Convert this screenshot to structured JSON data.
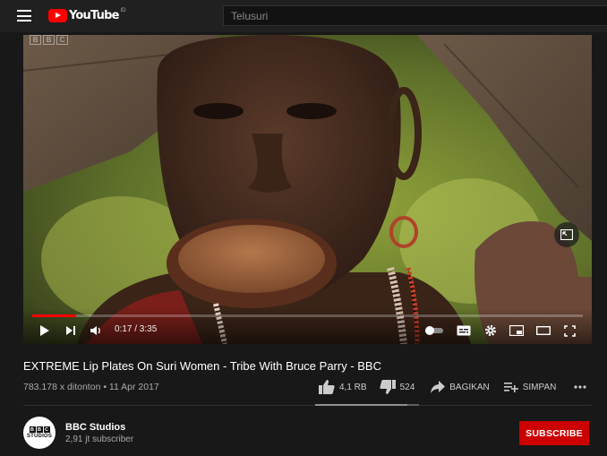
{
  "header": {
    "logo_text": "YouTube",
    "logo_country": "ID",
    "search_placeholder": "Telusuri"
  },
  "player": {
    "watermark": [
      "B",
      "B",
      "C"
    ],
    "current_time": "0:17",
    "duration": "3:35",
    "time_display": "0:17 / 3:35",
    "progress_fraction": 0.08
  },
  "video": {
    "title": "EXTREME Lip Plates On Suri Women - Tribe With Bruce Parry - BBC",
    "meta": "783.178 x ditonton • 11 Apr 2017",
    "likes": "4,1 RB",
    "dislikes": "524",
    "share_label": "BAGIKAN",
    "save_label": "SIMPAN",
    "like_ratio": 0.89
  },
  "channel": {
    "avatar_letters": [
      "B",
      "B",
      "C"
    ],
    "avatar_sub": "STUDIOS",
    "name": "BBC Studios",
    "subscribers": "2,91 jt subscriber",
    "subscribe_label": "SUBSCRIBE"
  },
  "colors": {
    "background": "#181818",
    "accent": "#ff0000",
    "subscribe": "#cc0000"
  }
}
